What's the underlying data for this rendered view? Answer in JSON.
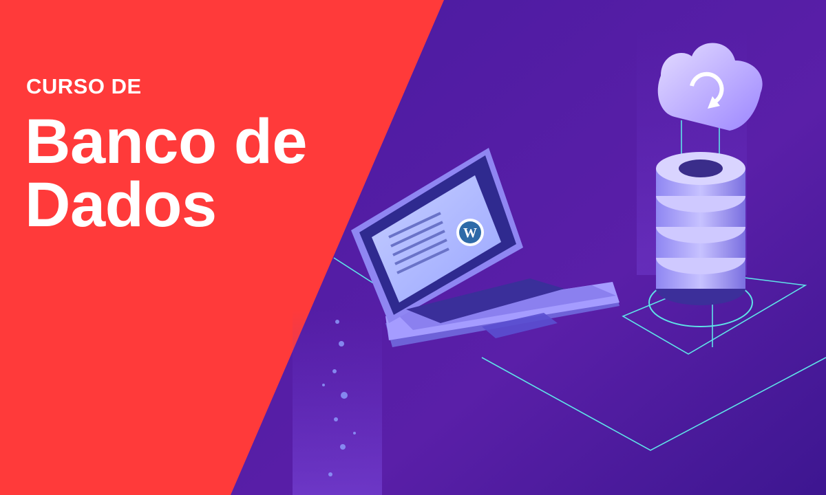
{
  "banner": {
    "subtitle": "CURSO DE",
    "title_line1": "Banco de",
    "title_line2": "Dados"
  },
  "colors": {
    "left_panel": "#ff3a3a",
    "right_panel": "#4a1fa0",
    "accent_line": "#5fe3e8",
    "device_light": "#b9b2ff"
  },
  "icons": [
    "laptop-illustration",
    "wordpress-logo-icon",
    "database-illustration",
    "cloud-sync-icon"
  ]
}
